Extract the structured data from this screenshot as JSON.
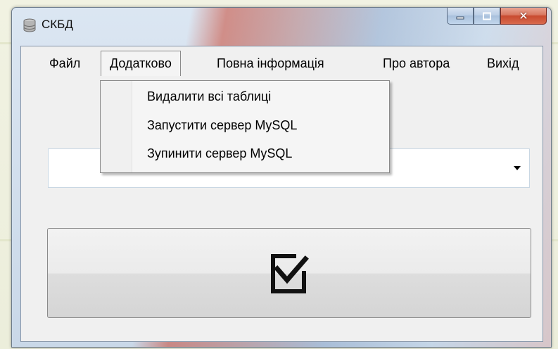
{
  "window": {
    "title": "СКБД",
    "icon": "database-icon",
    "caption_buttons": [
      "minimize-icon",
      "maximize-icon",
      "close-icon"
    ]
  },
  "menubar": {
    "items": [
      {
        "label": "Файл"
      },
      {
        "label": "Додатково",
        "active": true
      },
      {
        "label": "Повна інформація"
      },
      {
        "label": "Про автора"
      },
      {
        "label": "Вихід"
      }
    ]
  },
  "dropdown": {
    "items": [
      {
        "label": "Видалити всі таблиці"
      },
      {
        "label": "Запустити сервер MySQL"
      },
      {
        "label": "Зупинити сервер MySQL"
      }
    ]
  },
  "combo": {
    "value": "",
    "icon": "dropdown-arrow-icon"
  },
  "action_button": {
    "icon": "checkbox-checked-icon"
  }
}
